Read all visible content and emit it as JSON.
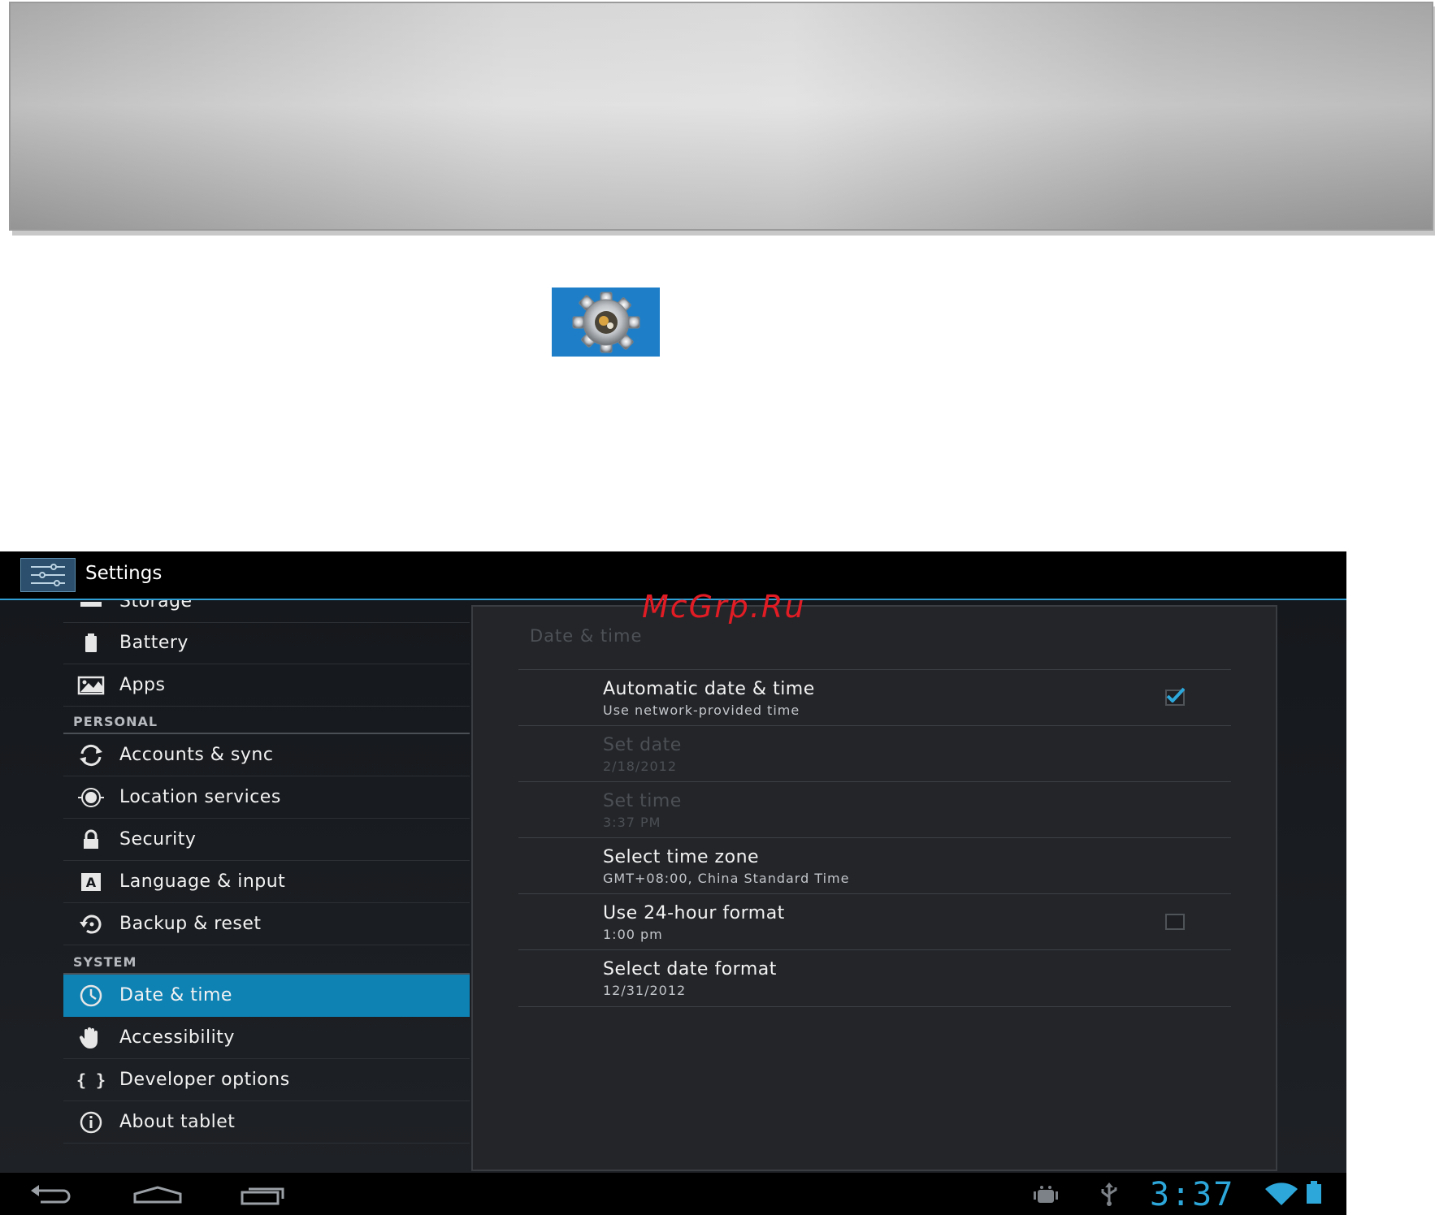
{
  "watermark": "McGrp.Ru",
  "settings": {
    "title": "Settings",
    "left_items": [
      {
        "label": "Storage",
        "icon": "storage-icon"
      },
      {
        "label": "Battery",
        "icon": "battery-icon"
      },
      {
        "label": "Apps",
        "icon": "apps-icon"
      }
    ],
    "section_personal": "PERSONAL",
    "personal_items": [
      {
        "label": "Accounts & sync",
        "icon": "sync-icon"
      },
      {
        "label": "Location services",
        "icon": "location-icon"
      },
      {
        "label": "Security",
        "icon": "lock-icon"
      },
      {
        "label": "Language & input",
        "icon": "language-icon"
      },
      {
        "label": "Backup & reset",
        "icon": "backup-icon"
      }
    ],
    "section_system": "SYSTEM",
    "system_items": [
      {
        "label": "Date & time",
        "icon": "clock-icon",
        "selected": true
      },
      {
        "label": "Accessibility",
        "icon": "hand-icon"
      },
      {
        "label": "Developer options",
        "icon": "braces-icon"
      },
      {
        "label": "About tablet",
        "icon": "info-icon"
      }
    ]
  },
  "panel": {
    "title": "Date & time",
    "prefs": [
      {
        "title": "Automatic date & time",
        "summary": "Use network-provided time",
        "checkbox": true,
        "checked": true,
        "enabled": true
      },
      {
        "title": "Set date",
        "summary": "2/18/2012",
        "enabled": false
      },
      {
        "title": "Set time",
        "summary": "3:37 PM",
        "enabled": false
      },
      {
        "title": "Select time zone",
        "summary": "GMT+08:00, China Standard Time",
        "enabled": true
      },
      {
        "title": "Use 24-hour format",
        "summary": "1:00 pm",
        "checkbox": true,
        "checked": false,
        "enabled": true
      },
      {
        "title": "Select date format",
        "summary": "12/31/2012",
        "enabled": true
      }
    ]
  },
  "status_bar": {
    "clock": "3:37"
  },
  "colors": {
    "accent": "#0f82b4",
    "holo_blue": "#2da7da",
    "background": "#1e2125"
  }
}
